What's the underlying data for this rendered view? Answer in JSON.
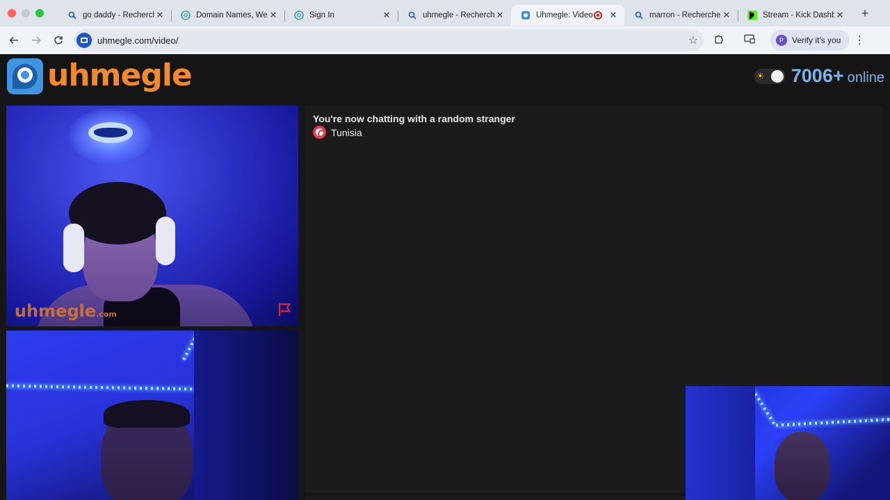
{
  "browser": {
    "tabs": [
      {
        "title": "go daddy - Recherche",
        "icon": "search-icon",
        "active": false
      },
      {
        "title": "Domain Names, Websites",
        "icon": "cloud-icon",
        "active": false
      },
      {
        "title": "Sign In",
        "icon": "cloud-icon",
        "active": false
      },
      {
        "title": "uhmegle - Recherche",
        "icon": "search-icon",
        "active": false
      },
      {
        "title": "Uhmegle: Video",
        "icon": "uhmegle-icon",
        "active": true,
        "recording": true
      },
      {
        "title": "marron - Recherche",
        "icon": "search-icon",
        "active": false
      },
      {
        "title": "Stream - Kick Dashboard",
        "icon": "kick-icon",
        "active": false
      }
    ],
    "new_tab": "+",
    "url": "uhmegle.com/video/",
    "verify_label": "Verify it's you",
    "profile_initial": "P"
  },
  "header": {
    "logo_text": "uhmegle",
    "online_count": "7006+",
    "online_label": "online"
  },
  "stranger_video": {
    "watermark": "uhmegle",
    "watermark_suffix": ".com"
  },
  "chat": {
    "status": "You're now chatting with a random stranger",
    "country": "Tunisia"
  },
  "colors": {
    "accent_orange": "#f08a2c",
    "online_blue": "#7ab3ea",
    "page_bg": "#161616",
    "chat_bg": "#1b1b1b"
  }
}
